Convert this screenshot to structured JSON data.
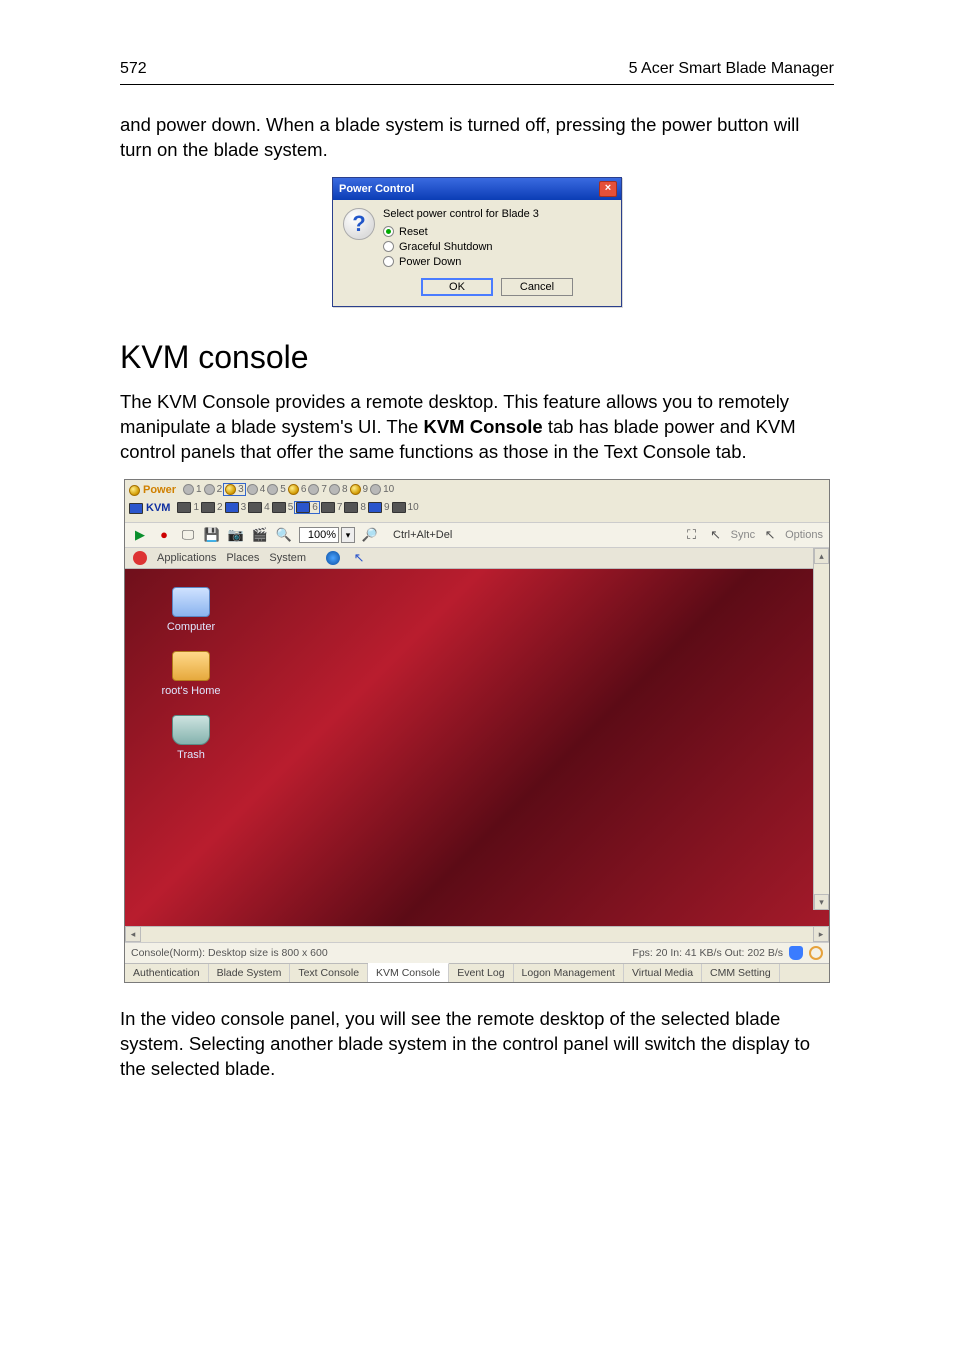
{
  "header": {
    "page_number": "572",
    "chapter": "5 Acer Smart Blade Manager"
  },
  "intro_text": "and power down. When a blade system is turned off, pressing the power button will turn on the blade system.",
  "dialog": {
    "title": "Power Control",
    "message": "Select power control for Blade 3",
    "options": [
      "Reset",
      "Graceful Shutdown",
      "Power Down"
    ],
    "selected_index": 0,
    "ok": "OK",
    "cancel": "Cancel"
  },
  "section_title": "KVM console",
  "section_text_1": "The KVM Console provides a remote desktop. This feature allows you to remotely manipulate a blade system's UI. The ",
  "section_text_bold": "KVM Console",
  "section_text_2": " tab has blade power and KVM control panels that offer the same functions as those in the Text Console tab.",
  "kvm": {
    "power_label": "Power",
    "kvm_label": "KVM",
    "slots": [
      1,
      2,
      3,
      4,
      5,
      6,
      7,
      8,
      9,
      10
    ],
    "power_on_slots": [
      3,
      6,
      9
    ],
    "kvm_on_slots": [
      3,
      6,
      9
    ],
    "power_selected_slot": 3,
    "kvm_selected_slot": 6,
    "toolbar": {
      "zoom_value": "100%",
      "cad_label": "Ctrl+Alt+Del",
      "sync_label": "Sync",
      "options_label": "Options"
    },
    "gnome": {
      "menu": [
        "Applications",
        "Places",
        "System"
      ],
      "icons": [
        {
          "label": "Computer",
          "kind": "comp"
        },
        {
          "label": "root's Home",
          "kind": "fold"
        },
        {
          "label": "Trash",
          "kind": "trash"
        }
      ]
    },
    "status_left": "Console(Norm): Desktop size is 800 x 600",
    "status_right": "Fps: 20 In: 41 KB/s Out: 202 B/s",
    "tabs": [
      "Authentication",
      "Blade System",
      "Text Console",
      "KVM Console",
      "Event Log",
      "Logon Management",
      "Virtual Media",
      "CMM Setting"
    ],
    "active_tab_index": 3
  },
  "outro_text": "In the video console panel, you will see the remote desktop of the selected blade system. Selecting another blade system in the control panel will switch the display to the selected blade."
}
